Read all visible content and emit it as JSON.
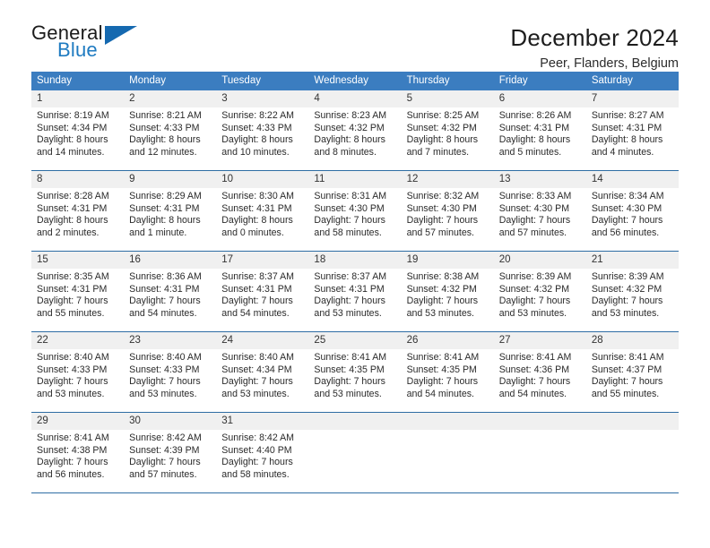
{
  "brand": {
    "name_part1": "General",
    "name_part2": "Blue",
    "colors": {
      "blue": "#1f7bc1",
      "triangle": "#1569b0",
      "dark": "#1b1b1b"
    }
  },
  "header": {
    "title": "December 2024",
    "subtitle": "Peer, Flanders, Belgium"
  },
  "theme": {
    "header_bg": "#3b7dc0",
    "row_divider": "#2e6da4",
    "daynum_bg": "#f0f0f0"
  },
  "calendar": {
    "weekday_headers": [
      "Sunday",
      "Monday",
      "Tuesday",
      "Wednesday",
      "Thursday",
      "Friday",
      "Saturday"
    ],
    "labels": {
      "sunrise": "Sunrise:",
      "sunset": "Sunset:",
      "daylight": "Daylight:"
    },
    "weeks": [
      [
        {
          "day": "1",
          "sunrise": "Sunrise: 8:19 AM",
          "sunset": "Sunset: 4:34 PM",
          "daylight1": "Daylight: 8 hours",
          "daylight2": "and 14 minutes."
        },
        {
          "day": "2",
          "sunrise": "Sunrise: 8:21 AM",
          "sunset": "Sunset: 4:33 PM",
          "daylight1": "Daylight: 8 hours",
          "daylight2": "and 12 minutes."
        },
        {
          "day": "3",
          "sunrise": "Sunrise: 8:22 AM",
          "sunset": "Sunset: 4:33 PM",
          "daylight1": "Daylight: 8 hours",
          "daylight2": "and 10 minutes."
        },
        {
          "day": "4",
          "sunrise": "Sunrise: 8:23 AM",
          "sunset": "Sunset: 4:32 PM",
          "daylight1": "Daylight: 8 hours",
          "daylight2": "and 8 minutes."
        },
        {
          "day": "5",
          "sunrise": "Sunrise: 8:25 AM",
          "sunset": "Sunset: 4:32 PM",
          "daylight1": "Daylight: 8 hours",
          "daylight2": "and 7 minutes."
        },
        {
          "day": "6",
          "sunrise": "Sunrise: 8:26 AM",
          "sunset": "Sunset: 4:31 PM",
          "daylight1": "Daylight: 8 hours",
          "daylight2": "and 5 minutes."
        },
        {
          "day": "7",
          "sunrise": "Sunrise: 8:27 AM",
          "sunset": "Sunset: 4:31 PM",
          "daylight1": "Daylight: 8 hours",
          "daylight2": "and 4 minutes."
        }
      ],
      [
        {
          "day": "8",
          "sunrise": "Sunrise: 8:28 AM",
          "sunset": "Sunset: 4:31 PM",
          "daylight1": "Daylight: 8 hours",
          "daylight2": "and 2 minutes."
        },
        {
          "day": "9",
          "sunrise": "Sunrise: 8:29 AM",
          "sunset": "Sunset: 4:31 PM",
          "daylight1": "Daylight: 8 hours",
          "daylight2": "and 1 minute."
        },
        {
          "day": "10",
          "sunrise": "Sunrise: 8:30 AM",
          "sunset": "Sunset: 4:31 PM",
          "daylight1": "Daylight: 8 hours",
          "daylight2": "and 0 minutes."
        },
        {
          "day": "11",
          "sunrise": "Sunrise: 8:31 AM",
          "sunset": "Sunset: 4:30 PM",
          "daylight1": "Daylight: 7 hours",
          "daylight2": "and 58 minutes."
        },
        {
          "day": "12",
          "sunrise": "Sunrise: 8:32 AM",
          "sunset": "Sunset: 4:30 PM",
          "daylight1": "Daylight: 7 hours",
          "daylight2": "and 57 minutes."
        },
        {
          "day": "13",
          "sunrise": "Sunrise: 8:33 AM",
          "sunset": "Sunset: 4:30 PM",
          "daylight1": "Daylight: 7 hours",
          "daylight2": "and 57 minutes."
        },
        {
          "day": "14",
          "sunrise": "Sunrise: 8:34 AM",
          "sunset": "Sunset: 4:30 PM",
          "daylight1": "Daylight: 7 hours",
          "daylight2": "and 56 minutes."
        }
      ],
      [
        {
          "day": "15",
          "sunrise": "Sunrise: 8:35 AM",
          "sunset": "Sunset: 4:31 PM",
          "daylight1": "Daylight: 7 hours",
          "daylight2": "and 55 minutes."
        },
        {
          "day": "16",
          "sunrise": "Sunrise: 8:36 AM",
          "sunset": "Sunset: 4:31 PM",
          "daylight1": "Daylight: 7 hours",
          "daylight2": "and 54 minutes."
        },
        {
          "day": "17",
          "sunrise": "Sunrise: 8:37 AM",
          "sunset": "Sunset: 4:31 PM",
          "daylight1": "Daylight: 7 hours",
          "daylight2": "and 54 minutes."
        },
        {
          "day": "18",
          "sunrise": "Sunrise: 8:37 AM",
          "sunset": "Sunset: 4:31 PM",
          "daylight1": "Daylight: 7 hours",
          "daylight2": "and 53 minutes."
        },
        {
          "day": "19",
          "sunrise": "Sunrise: 8:38 AM",
          "sunset": "Sunset: 4:32 PM",
          "daylight1": "Daylight: 7 hours",
          "daylight2": "and 53 minutes."
        },
        {
          "day": "20",
          "sunrise": "Sunrise: 8:39 AM",
          "sunset": "Sunset: 4:32 PM",
          "daylight1": "Daylight: 7 hours",
          "daylight2": "and 53 minutes."
        },
        {
          "day": "21",
          "sunrise": "Sunrise: 8:39 AM",
          "sunset": "Sunset: 4:32 PM",
          "daylight1": "Daylight: 7 hours",
          "daylight2": "and 53 minutes."
        }
      ],
      [
        {
          "day": "22",
          "sunrise": "Sunrise: 8:40 AM",
          "sunset": "Sunset: 4:33 PM",
          "daylight1": "Daylight: 7 hours",
          "daylight2": "and 53 minutes."
        },
        {
          "day": "23",
          "sunrise": "Sunrise: 8:40 AM",
          "sunset": "Sunset: 4:33 PM",
          "daylight1": "Daylight: 7 hours",
          "daylight2": "and 53 minutes."
        },
        {
          "day": "24",
          "sunrise": "Sunrise: 8:40 AM",
          "sunset": "Sunset: 4:34 PM",
          "daylight1": "Daylight: 7 hours",
          "daylight2": "and 53 minutes."
        },
        {
          "day": "25",
          "sunrise": "Sunrise: 8:41 AM",
          "sunset": "Sunset: 4:35 PM",
          "daylight1": "Daylight: 7 hours",
          "daylight2": "and 53 minutes."
        },
        {
          "day": "26",
          "sunrise": "Sunrise: 8:41 AM",
          "sunset": "Sunset: 4:35 PM",
          "daylight1": "Daylight: 7 hours",
          "daylight2": "and 54 minutes."
        },
        {
          "day": "27",
          "sunrise": "Sunrise: 8:41 AM",
          "sunset": "Sunset: 4:36 PM",
          "daylight1": "Daylight: 7 hours",
          "daylight2": "and 54 minutes."
        },
        {
          "day": "28",
          "sunrise": "Sunrise: 8:41 AM",
          "sunset": "Sunset: 4:37 PM",
          "daylight1": "Daylight: 7 hours",
          "daylight2": "and 55 minutes."
        }
      ],
      [
        {
          "day": "29",
          "sunrise": "Sunrise: 8:41 AM",
          "sunset": "Sunset: 4:38 PM",
          "daylight1": "Daylight: 7 hours",
          "daylight2": "and 56 minutes."
        },
        {
          "day": "30",
          "sunrise": "Sunrise: 8:42 AM",
          "sunset": "Sunset: 4:39 PM",
          "daylight1": "Daylight: 7 hours",
          "daylight2": "and 57 minutes."
        },
        {
          "day": "31",
          "sunrise": "Sunrise: 8:42 AM",
          "sunset": "Sunset: 4:40 PM",
          "daylight1": "Daylight: 7 hours",
          "daylight2": "and 58 minutes."
        },
        {
          "day": "",
          "sunrise": "",
          "sunset": "",
          "daylight1": "",
          "daylight2": ""
        },
        {
          "day": "",
          "sunrise": "",
          "sunset": "",
          "daylight1": "",
          "daylight2": ""
        },
        {
          "day": "",
          "sunrise": "",
          "sunset": "",
          "daylight1": "",
          "daylight2": ""
        },
        {
          "day": "",
          "sunrise": "",
          "sunset": "",
          "daylight1": "",
          "daylight2": ""
        }
      ]
    ]
  }
}
